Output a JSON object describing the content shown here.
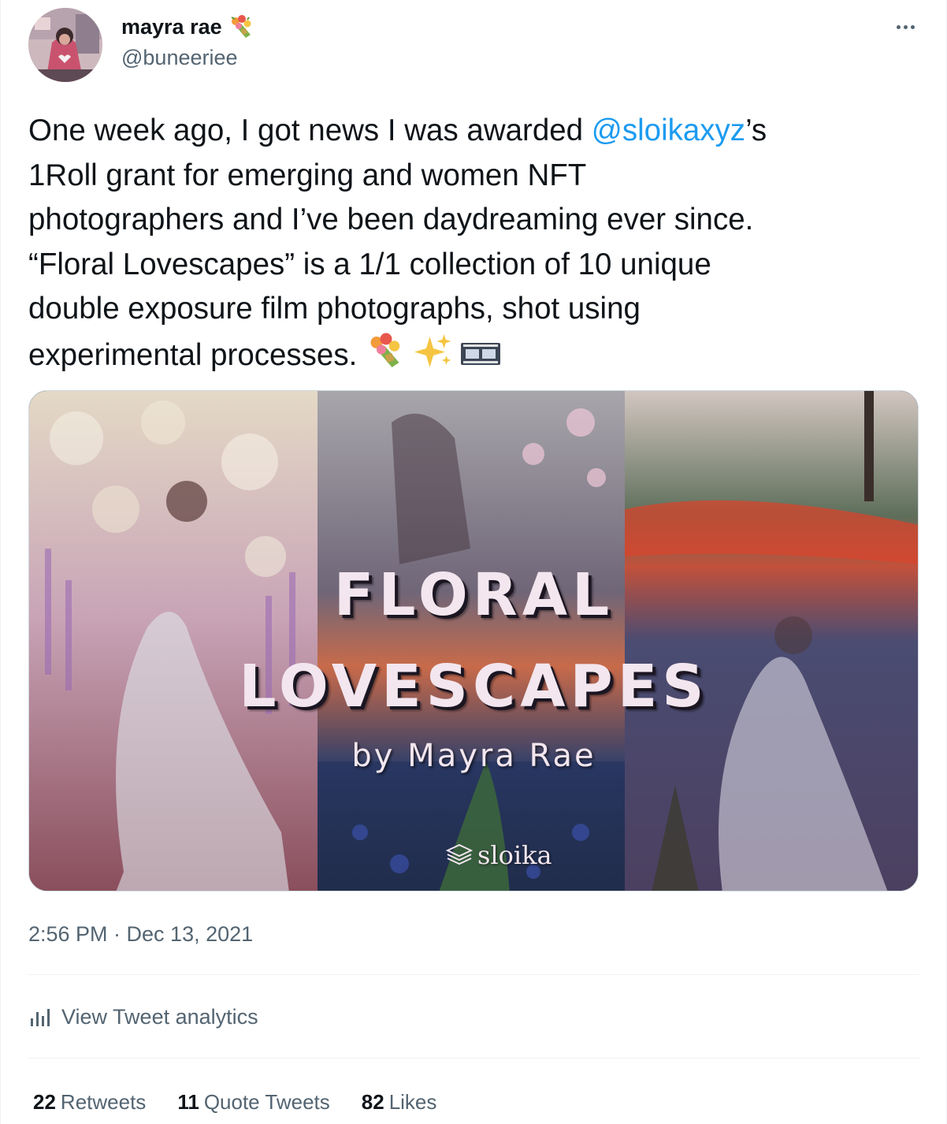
{
  "author": {
    "display_name": "mayra rae",
    "name_emoji": "bouquet-emoji",
    "handle": "@buneeriee",
    "verified": false
  },
  "tweet": {
    "lines": [
      {
        "before": "One week ago, I got news I was awarded ",
        "mention": "@sloikaxyz",
        "after": "’s"
      },
      {
        "text": "1Roll grant for emerging and women NFT"
      },
      {
        "text": "photographers and I’ve been daydreaming ever since."
      },
      {
        "text": "“Floral Lovescapes” is a 1/1 collection of 10 unique"
      },
      {
        "text": "double exposure film photographs, shot using"
      },
      {
        "text": "experimental processes."
      }
    ],
    "trailing_emojis": [
      "bouquet-emoji",
      "sparkles-emoji",
      "film-frames-emoji"
    ]
  },
  "media": {
    "title_line1": "FLORAL",
    "title_line2": "LOVESCAPES",
    "byline": "by Mayra Rae",
    "brand": "sloika"
  },
  "timestamp": "2:56 PM · Dec 13, 2021",
  "analytics_label": "View Tweet analytics",
  "stats": {
    "retweets_count": "22",
    "retweets_label": "Retweets",
    "quotes_count": "11",
    "quotes_label": "Quote Tweets",
    "likes_count": "82",
    "likes_label": "Likes"
  },
  "colors": {
    "link": "#1d9bf0",
    "secondary_text": "#536471",
    "primary_text": "#0f1419",
    "border": "#cfd9de"
  }
}
